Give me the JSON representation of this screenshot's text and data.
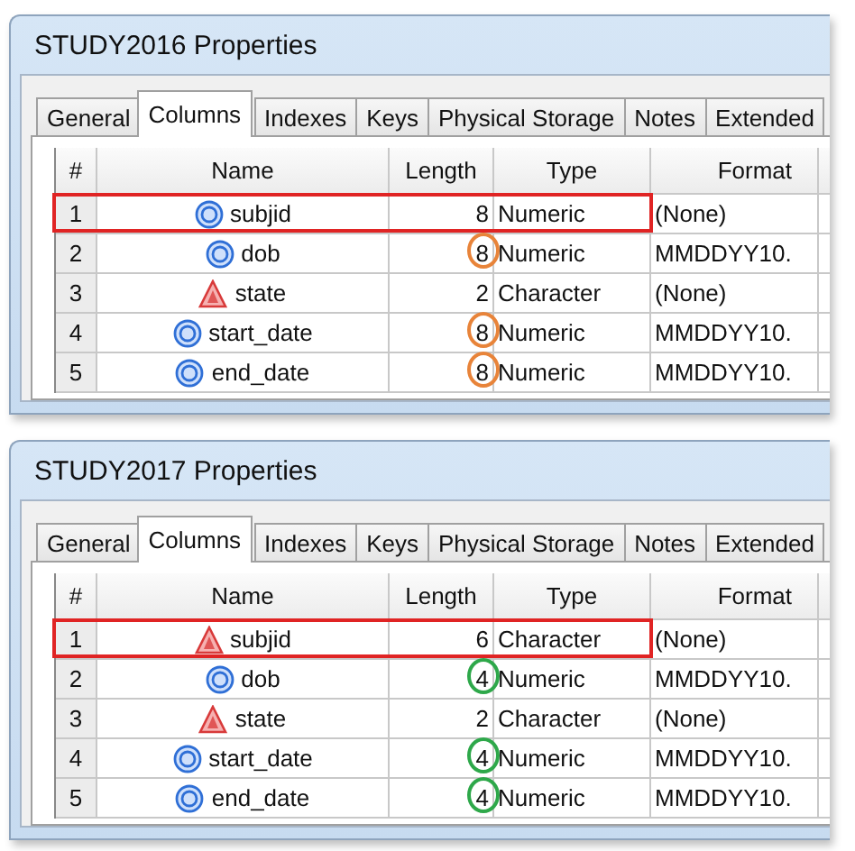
{
  "panels": [
    {
      "window": {
        "title": "STUDY2016 Properties"
      },
      "tabs": [
        {
          "label": "General",
          "selected": false
        },
        {
          "label": "Columns",
          "selected": true
        },
        {
          "label": "Indexes",
          "selected": false
        },
        {
          "label": "Keys",
          "selected": false
        },
        {
          "label": "Physical Storage",
          "selected": false
        },
        {
          "label": "Notes",
          "selected": false
        },
        {
          "label": "Extended",
          "selected": false
        }
      ],
      "table": {
        "columns": [
          "#",
          "Name",
          "Length",
          "Type",
          "Format"
        ],
        "rows": [
          {
            "num": "1",
            "kind": "numeric",
            "name": "subjid",
            "length": "8",
            "type": "Numeric",
            "format": "(None)",
            "highlighted": true
          },
          {
            "num": "2",
            "kind": "numeric",
            "name": "dob",
            "length": "8",
            "type": "Numeric",
            "format": "MMDDYY10.",
            "highlighted": false,
            "color": "#e8843a"
          },
          {
            "num": "3",
            "kind": "character",
            "name": "state",
            "length": "2",
            "type": "Character",
            "format": "(None)",
            "highlighted": false
          },
          {
            "num": "4",
            "kind": "numeric",
            "name": "start_date",
            "length": "8",
            "type": "Numeric",
            "format": "MMDDYY10.",
            "highlighted": false,
            "color": "#e8843a"
          },
          {
            "num": "5",
            "kind": "numeric",
            "name": "end_date",
            "length": "8",
            "type": "Numeric",
            "format": "MMDDYY10.",
            "highlighted": false,
            "color": "#e8843a"
          }
        ]
      }
    },
    {
      "window": {
        "title": "STUDY2017 Properties"
      },
      "tabs": [
        {
          "label": "General",
          "selected": false
        },
        {
          "label": "Columns",
          "selected": true
        },
        {
          "label": "Indexes",
          "selected": false
        },
        {
          "label": "Keys",
          "selected": false
        },
        {
          "label": "Physical Storage",
          "selected": false
        },
        {
          "label": "Notes",
          "selected": false
        },
        {
          "label": "Extended",
          "selected": false
        }
      ],
      "table": {
        "columns": [
          "#",
          "Name",
          "Length",
          "Type",
          "Format"
        ],
        "rows": [
          {
            "num": "1",
            "kind": "character",
            "name": "subjid",
            "length": "6",
            "type": "Character",
            "format": "(None)",
            "highlighted": true
          },
          {
            "num": "2",
            "kind": "numeric",
            "name": "dob",
            "length": "4",
            "type": "Numeric",
            "format": "MMDDYY10.",
            "highlighted": false,
            "color": "#2ea84a"
          },
          {
            "num": "3",
            "kind": "character",
            "name": "state",
            "length": "2",
            "type": "Character",
            "format": "(None)",
            "highlighted": false
          },
          {
            "num": "4",
            "kind": "numeric",
            "name": "start_date",
            "length": "4",
            "type": "Numeric",
            "format": "MMDDYY10.",
            "highlighted": false,
            "color": "#2ea84a"
          },
          {
            "num": "5",
            "kind": "numeric",
            "name": "end_date",
            "length": "4",
            "type": "Numeric",
            "format": "MMDDYY10.",
            "highlighted": false,
            "color": "#2ea84a"
          }
        ]
      }
    }
  ]
}
